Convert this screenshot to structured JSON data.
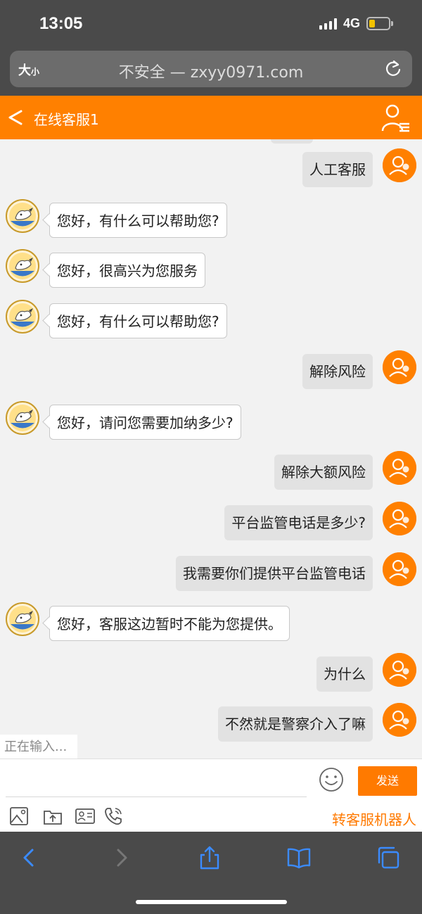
{
  "status": {
    "time": "13:05",
    "network": "4G"
  },
  "browser": {
    "text_size_label": "大",
    "text_size_small": "小",
    "url": "不安全 — zxyy0971.com"
  },
  "header": {
    "title": "在线客服1"
  },
  "messages": [
    {
      "side": "right",
      "text": "人工客服"
    },
    {
      "side": "left",
      "text": "您好，有什么可以帮助您?"
    },
    {
      "side": "left",
      "text": "您好，很高兴为您服务"
    },
    {
      "side": "left",
      "text": "您好，有什么可以帮助您?"
    },
    {
      "side": "right",
      "text": "解除风险"
    },
    {
      "side": "left",
      "text": "您好，请问您需要加纳多少?"
    },
    {
      "side": "right",
      "text": "解除大额风险"
    },
    {
      "side": "right",
      "text": "平台监管电话是多少?"
    },
    {
      "side": "right",
      "text": "我需要你们提供平台监管电话"
    },
    {
      "side": "left",
      "text": "您好，客服这边暂时不能为您提供。"
    },
    {
      "side": "right",
      "text": "为什么"
    },
    {
      "side": "right",
      "text": "不然就是警察介入了嘛"
    }
  ],
  "typing_indicator": "正在输入...",
  "composer": {
    "placeholder": "",
    "send_label": "发送",
    "switch_label": "转客服机器人",
    "tools": [
      "image-icon",
      "file-upload-icon",
      "contact-card-icon",
      "phone-icon"
    ]
  },
  "toolbar": {
    "icons": [
      "back-icon",
      "forward-icon",
      "share-icon",
      "bookmarks-icon",
      "tabs-icon"
    ]
  },
  "colors": {
    "accent": "#ff8000",
    "user_bubble": "#e2e2e2",
    "agent_bubble": "#ffffff"
  }
}
